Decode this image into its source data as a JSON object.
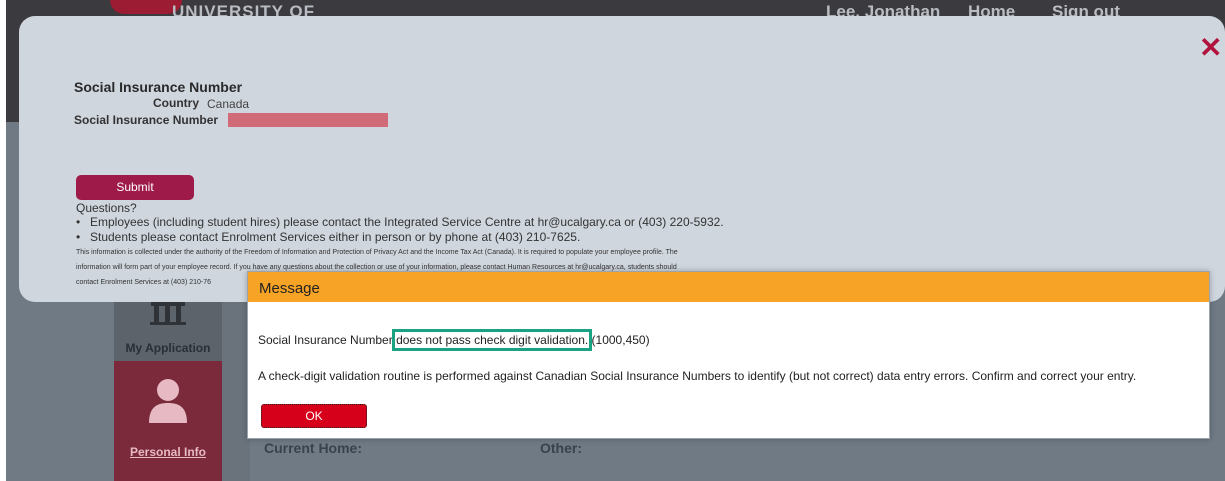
{
  "header": {
    "brand": "UNIVERSITY OF",
    "user": "Lee, Jonathan",
    "home_link": "Home",
    "signout_link": "Sign out"
  },
  "sidebar": {
    "items": [
      {
        "label": "My Application",
        "icon": "building-icon"
      },
      {
        "label": "Personal Info",
        "icon": "person-icon",
        "selected": true
      }
    ]
  },
  "background_labels": {
    "current_home": "Current Home:",
    "other": "Other:"
  },
  "form": {
    "heading": "Social Insurance Number",
    "country_label": "Country",
    "country_value": "Canada",
    "sin_label": "Social Insurance Number",
    "submit_label": "Submit",
    "questions_label": "Questions?",
    "bullets": [
      "Employees (including student hires) please contact the Integrated Service Centre at hr@ucalgary.ca or (403) 220-5932.",
      "Students please contact Enrolment Services either in person or by phone at (403) 210-7625."
    ],
    "fine_print": [
      "This information is collected under the authority of the Freedom of Information and Protection of Privacy Act and the Income Tax Act (Canada). It is required to populate your employee profile. The",
      "information will form part of your employee record. If you have any questions about the collection or use of your information, please contact Human Resources at hr@ucalgary.ca, students should",
      "contact Enrolment Services at (403) 210-76"
    ],
    "close_symbol": "✕"
  },
  "message": {
    "title": "Message",
    "line1_prefix": "Social Insurance Number ",
    "line1_highlight": "does not pass check digit validation.",
    "line1_suffix": " (1000,450)",
    "line2": "A check-digit validation routine is performed against Canadian Social Insurance Numbers to identify (but not correct) data entry errors.  Confirm and correct your entry.",
    "ok_label": "OK"
  },
  "colors": {
    "accent_orange": "#f7a325",
    "ok_red": "#d7001b",
    "submit_maroon": "#9e1a48",
    "highlight_teal": "#19a382"
  }
}
